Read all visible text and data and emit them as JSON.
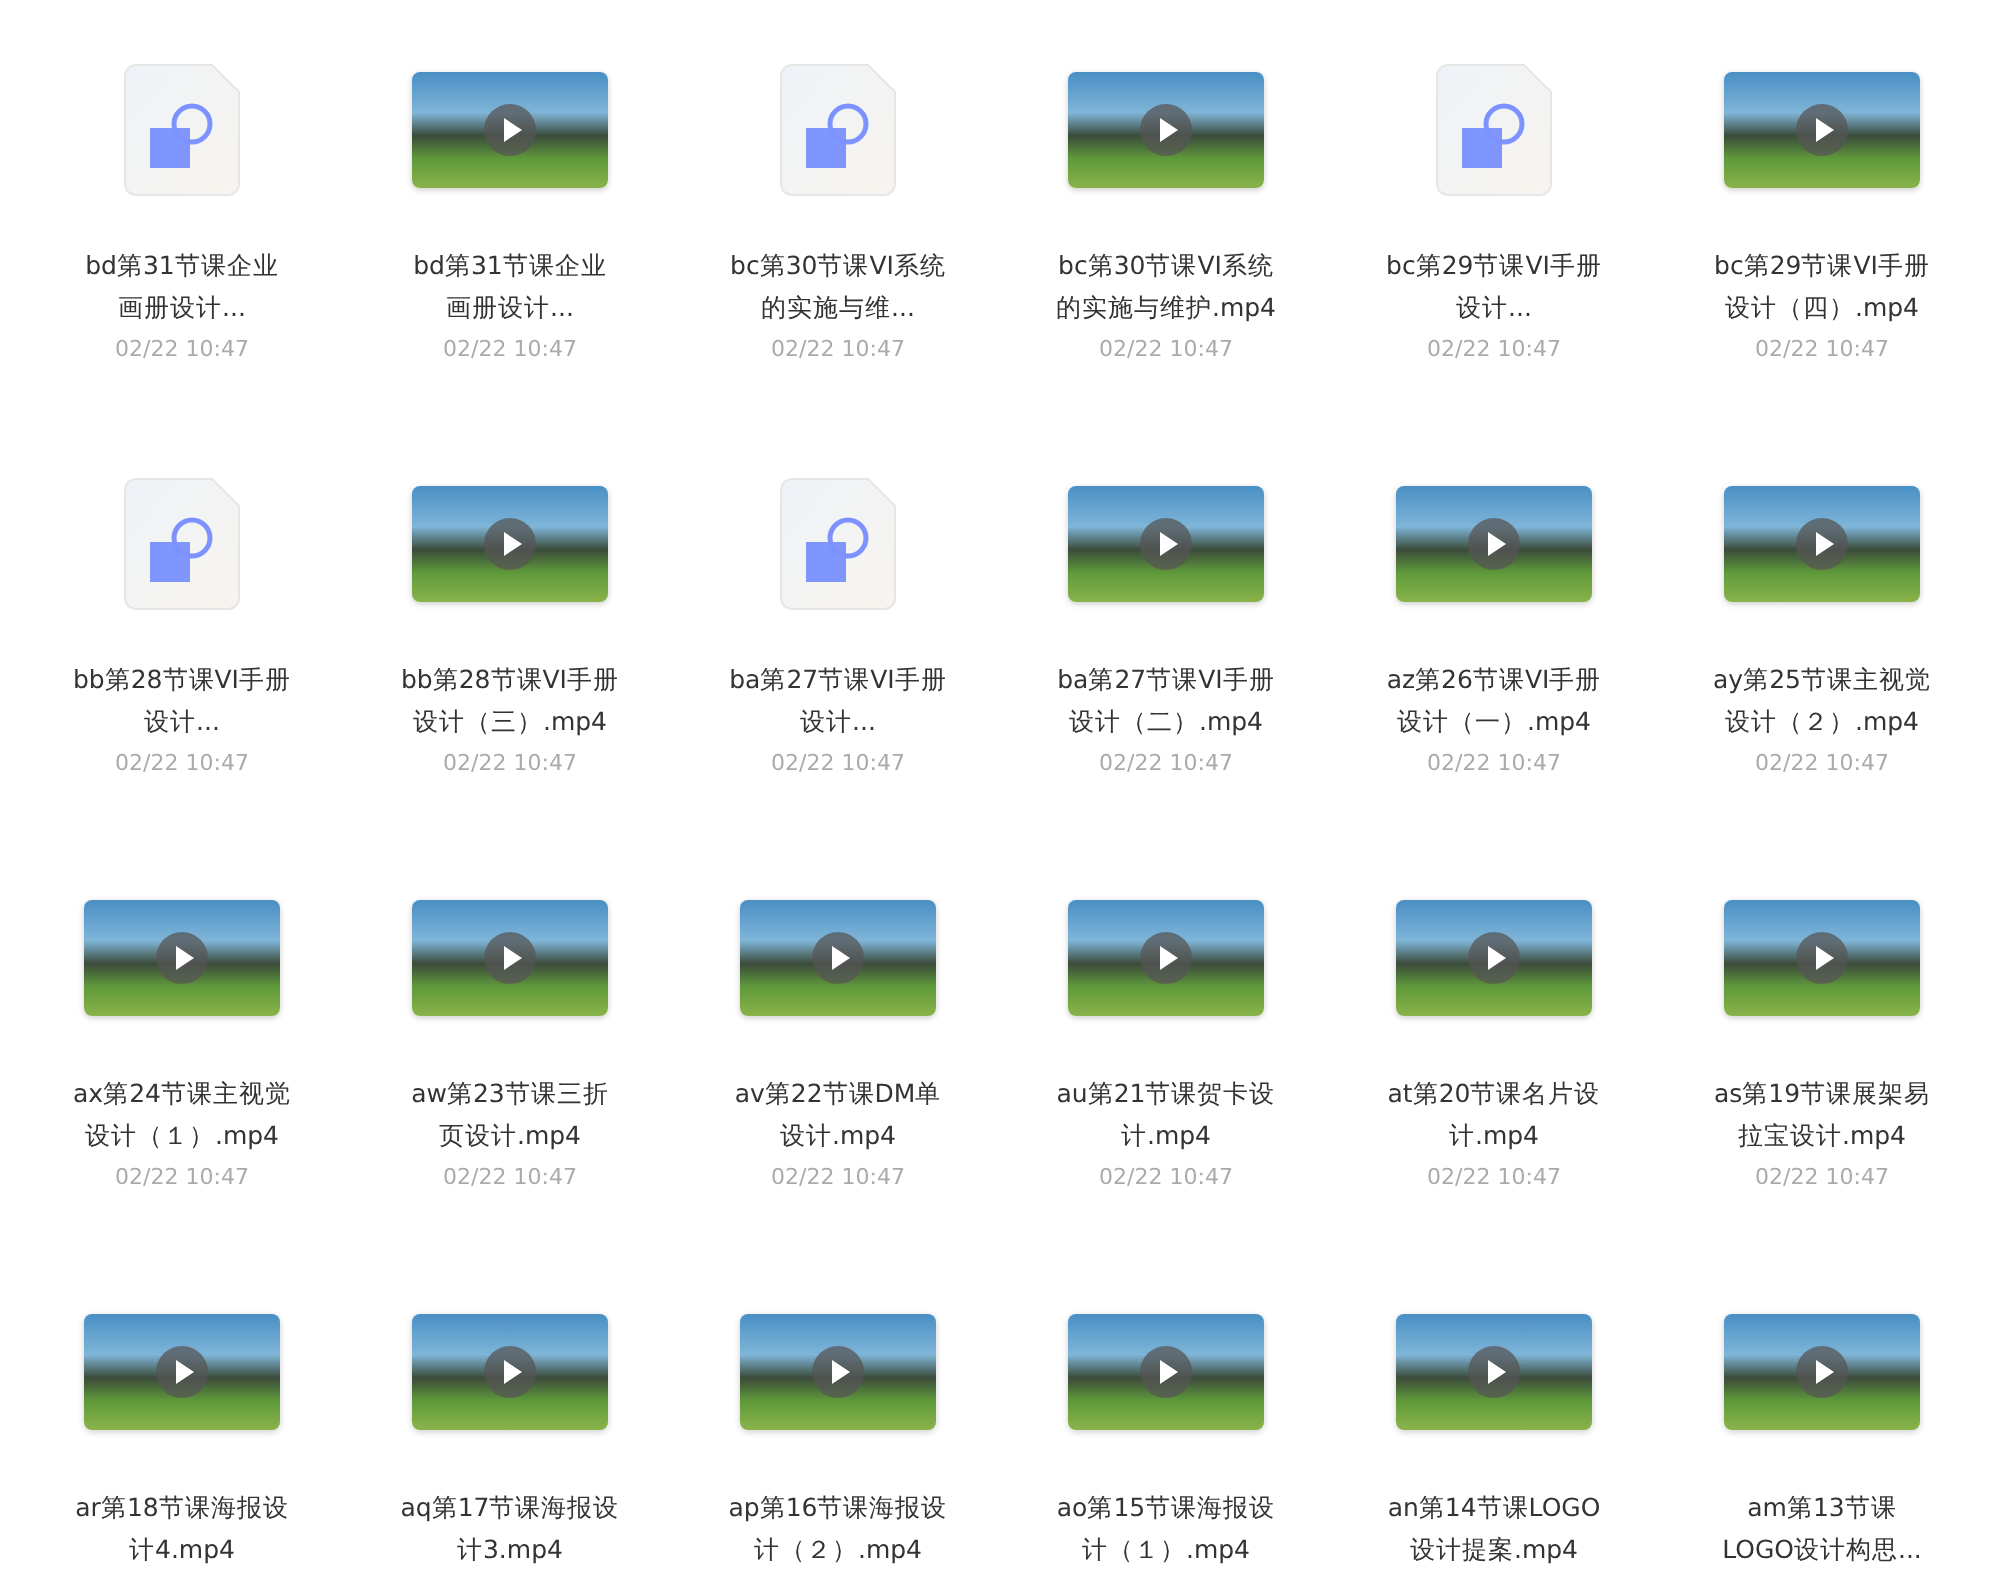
{
  "files": [
    {
      "kind": "design",
      "name_lines": [
        "bd第31节课企业",
        "画册设计..."
      ],
      "date": "02/22 10:47"
    },
    {
      "kind": "video",
      "name_lines": [
        "bd第31节课企业",
        "画册设计..."
      ],
      "date": "02/22 10:47"
    },
    {
      "kind": "design",
      "name_lines": [
        "bc第30节课VI系统",
        "的实施与维..."
      ],
      "date": "02/22 10:47"
    },
    {
      "kind": "video",
      "name_lines": [
        "bc第30节课VI系统",
        "的实施与维护.mp4"
      ],
      "date": "02/22 10:47"
    },
    {
      "kind": "design",
      "name_lines": [
        "bc第29节课VI手册",
        "设计..."
      ],
      "date": "02/22 10:47"
    },
    {
      "kind": "video",
      "name_lines": [
        "bc第29节课VI手册",
        "设计（四）.mp4"
      ],
      "date": "02/22 10:47"
    },
    {
      "kind": "design",
      "name_lines": [
        "bb第28节课VI手册",
        "设计..."
      ],
      "date": "02/22 10:47"
    },
    {
      "kind": "video",
      "name_lines": [
        "bb第28节课VI手册",
        "设计（三）.mp4"
      ],
      "date": "02/22 10:47"
    },
    {
      "kind": "design",
      "name_lines": [
        "ba第27节课VI手册",
        "设计..."
      ],
      "date": "02/22 10:47"
    },
    {
      "kind": "video",
      "name_lines": [
        "ba第27节课VI手册",
        "设计（二）.mp4"
      ],
      "date": "02/22 10:47"
    },
    {
      "kind": "video",
      "name_lines": [
        "az第26节课VI手册",
        "设计（一）.mp4"
      ],
      "date": "02/22 10:47"
    },
    {
      "kind": "video",
      "name_lines": [
        "ay第25节课主视觉",
        "设计（２）.mp4"
      ],
      "date": "02/22 10:47"
    },
    {
      "kind": "video",
      "name_lines": [
        "ax第24节课主视觉",
        "设计（１）.mp4"
      ],
      "date": "02/22 10:47"
    },
    {
      "kind": "video",
      "name_lines": [
        "aw第23节课三折",
        "页设计.mp4"
      ],
      "date": "02/22 10:47"
    },
    {
      "kind": "video",
      "name_lines": [
        "av第22节课DM单",
        "设计.mp4"
      ],
      "date": "02/22 10:47"
    },
    {
      "kind": "video",
      "name_lines": [
        "au第21节课贺卡设",
        "计.mp4"
      ],
      "date": "02/22 10:47"
    },
    {
      "kind": "video",
      "name_lines": [
        "at第20节课名片设",
        "计.mp4"
      ],
      "date": "02/22 10:47"
    },
    {
      "kind": "video",
      "name_lines": [
        "as第19节课展架易",
        "拉宝设计.mp4"
      ],
      "date": "02/22 10:47"
    },
    {
      "kind": "video",
      "name_lines": [
        "ar第18节课海报设",
        "计4.mp4"
      ]
    },
    {
      "kind": "video",
      "name_lines": [
        "aq第17节课海报设",
        "计3.mp4"
      ]
    },
    {
      "kind": "video",
      "name_lines": [
        "ap第16节课海报设",
        "计（２）.mp4"
      ]
    },
    {
      "kind": "video",
      "name_lines": [
        "ao第15节课海报设",
        "计（１）.mp4"
      ]
    },
    {
      "kind": "video",
      "name_lines": [
        "an第14节课LOGO",
        "设计提案.mp4"
      ]
    },
    {
      "kind": "video",
      "name_lines": [
        "am第13节课",
        "LOGO设计构思..."
      ]
    }
  ]
}
